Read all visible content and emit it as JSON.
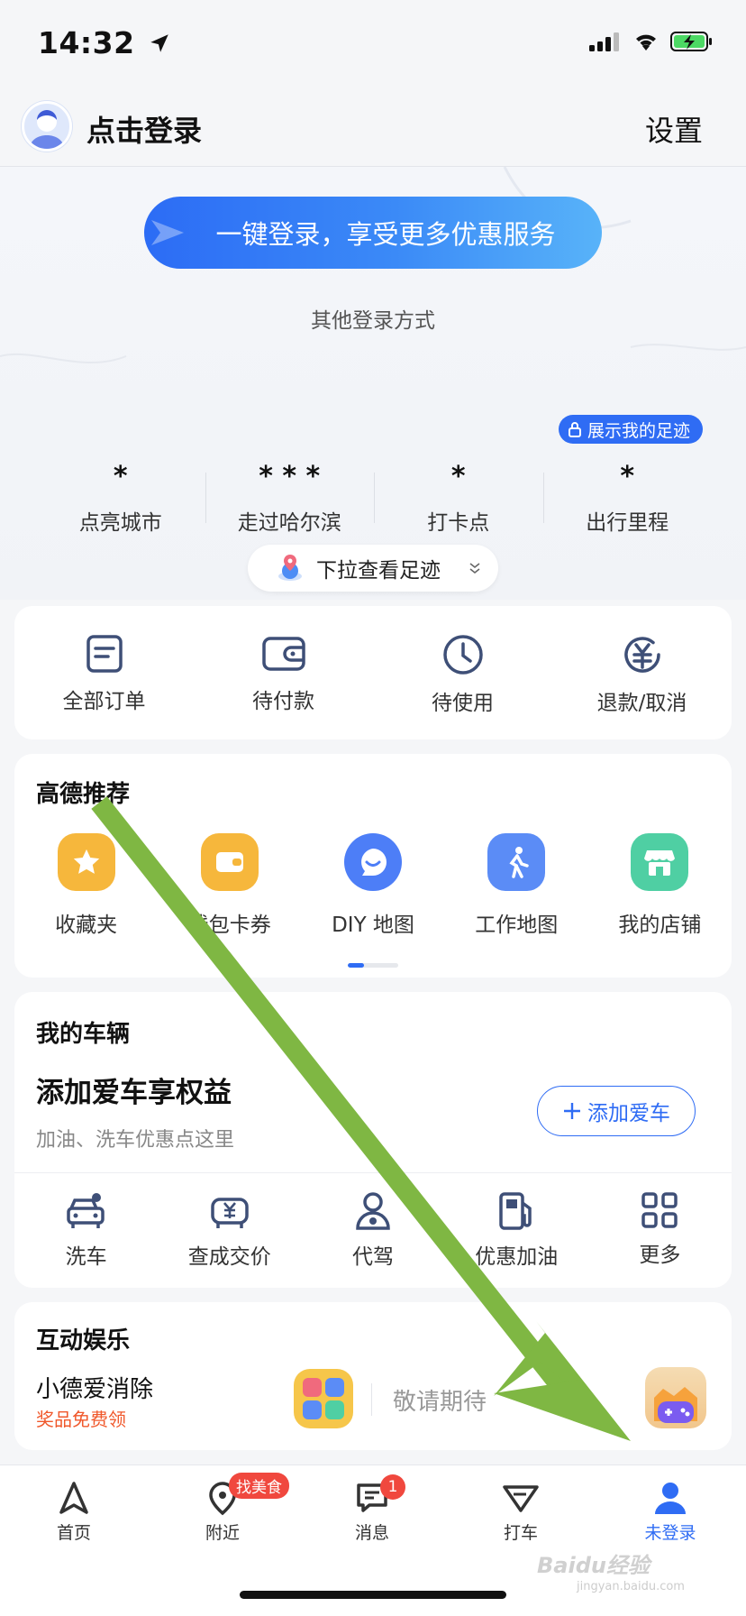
{
  "status_bar": {
    "time": "14:32"
  },
  "header": {
    "login": "点击登录",
    "settings": "设置"
  },
  "login_area": {
    "one_key": "一键登录，享受更多优惠服务",
    "other": "其他登录方式",
    "footprint_badge": "展示我的足迹"
  },
  "stats": [
    {
      "value": "*",
      "label": "点亮城市"
    },
    {
      "value": "* * *",
      "label": "走过哈尔滨"
    },
    {
      "value": "*",
      "label": "打卡点"
    },
    {
      "value": "*",
      "label": "出行里程"
    }
  ],
  "pull_pill": "下拉查看足迹",
  "orders": [
    {
      "label": "全部订单",
      "icon": "order-list-icon"
    },
    {
      "label": "待付款",
      "icon": "wallet-icon"
    },
    {
      "label": "待使用",
      "icon": "clock-icon"
    },
    {
      "label": "退款/取消",
      "icon": "refund-icon"
    }
  ],
  "recommend": {
    "title": "高德推荐",
    "items": [
      {
        "label": "收藏夹",
        "icon": "star-icon",
        "color": "#f6b73c"
      },
      {
        "label": "钱包卡券",
        "icon": "wallet-card-icon",
        "color": "#f6b73c"
      },
      {
        "label": "DIY 地图",
        "icon": "diy-map-icon",
        "color": "#4d7ef7"
      },
      {
        "label": "工作地图",
        "icon": "work-map-icon",
        "color": "#5b8cf6"
      },
      {
        "label": "我的店铺",
        "icon": "shop-icon",
        "color": "#4fcfa3"
      }
    ]
  },
  "vehicle": {
    "title": "我的车辆",
    "headline": "添加爱车享权益",
    "subline": "加油、洗车优惠点这里",
    "add_button": "添加爱车",
    "items": [
      {
        "label": "洗车",
        "icon": "car-wash-icon"
      },
      {
        "label": "查成交价",
        "icon": "car-price-icon"
      },
      {
        "label": "代驾",
        "icon": "driver-icon"
      },
      {
        "label": "优惠加油",
        "icon": "fuel-icon"
      },
      {
        "label": "更多",
        "icon": "grid-more-icon"
      }
    ]
  },
  "entertainment": {
    "title": "互动娱乐",
    "game_title": "小德爱消除",
    "game_sub": "奖品免费领",
    "coming": "敬请期待"
  },
  "tabbar": [
    {
      "label": "首页",
      "icon": "navigation-arrow-icon"
    },
    {
      "label": "附近",
      "icon": "location-pin-icon",
      "badge": "找美食"
    },
    {
      "label": "消息",
      "icon": "message-icon",
      "badge": "1"
    },
    {
      "label": "打车",
      "icon": "taxi-icon"
    },
    {
      "label": "未登录",
      "icon": "user-icon"
    }
  ],
  "watermark": {
    "main": "Baidu经验",
    "sub": "jingyan.baidu.com"
  },
  "colors": {
    "accent": "#2f6cf4",
    "annotation_arrow": "#7fb743",
    "badge_red": "#f0483e"
  }
}
